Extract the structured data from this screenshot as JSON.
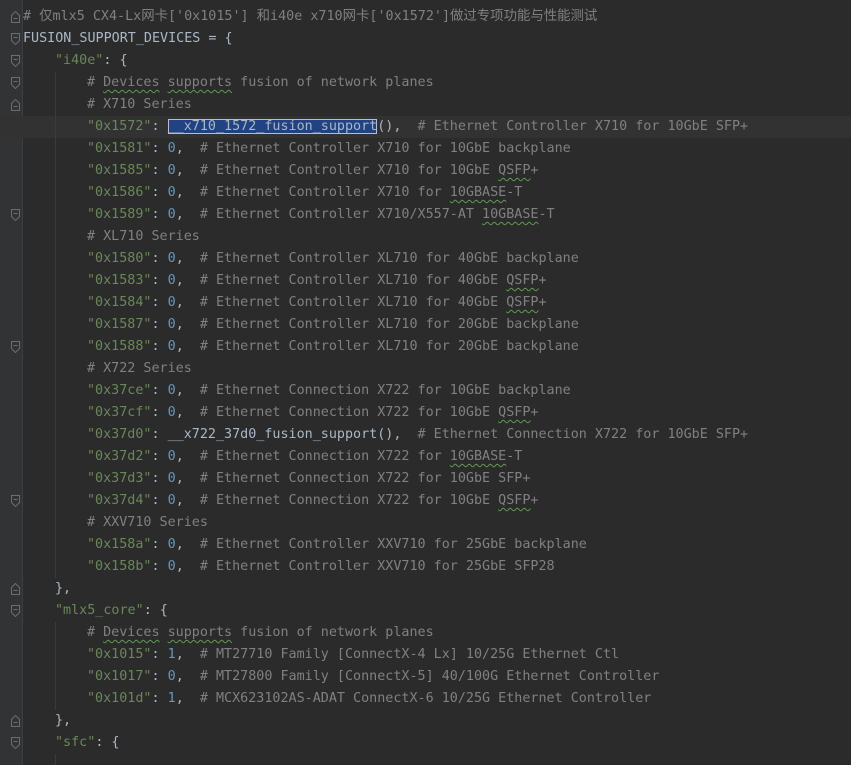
{
  "colors": {
    "background": "#2b2b2b",
    "gutter": "#313335",
    "text": "#a9b7c6",
    "string": "#6a8759",
    "number": "#6897bb",
    "comment": "#808080",
    "selection": "#214283"
  },
  "editor": {
    "lines": [
      {
        "indent": 0,
        "fold": "none",
        "tokens": [
          [
            "cm",
            "# ……………………"
          ]
        ]
      },
      {
        "indent": 0,
        "fold": "end",
        "tokens": [
          [
            "cm",
            "# 仅mlx5 CX4-Lx网卡['0x1015'] 和i40e x710网卡['0x1572']做过专项功能与性能测试"
          ]
        ]
      },
      {
        "indent": 0,
        "fold": "start",
        "tokens": [
          [
            "kw",
            "FUSION_SUPPORT_DEVICES = {"
          ]
        ]
      },
      {
        "indent": 1,
        "fold": "start",
        "tokens": [
          [
            "str",
            "\"i40e\""
          ],
          [
            "kw",
            ": {"
          ]
        ]
      },
      {
        "indent": 2,
        "fold": "start",
        "tokens": [
          [
            "cm",
            "# "
          ],
          [
            "cm spell",
            "Devices"
          ],
          [
            "cm",
            " "
          ],
          [
            "cm spell",
            "supports"
          ],
          [
            "cm",
            " fusion of network planes"
          ]
        ]
      },
      {
        "indent": 2,
        "fold": "end",
        "tokens": [
          [
            "cm",
            "# X710 Series"
          ]
        ]
      },
      {
        "indent": 2,
        "fold": "none",
        "current": true,
        "tokens": [
          [
            "str",
            "\"0x1572\""
          ],
          [
            "kw",
            ": "
          ],
          [
            "sel",
            "__x710_1572_fusion_support"
          ],
          [
            "kw",
            "(),  "
          ],
          [
            "cm",
            "# Ethernet Controller X710 for 10GbE SFP+"
          ]
        ]
      },
      {
        "indent": 2,
        "fold": "none",
        "tokens": [
          [
            "str",
            "\"0x1581\""
          ],
          [
            "kw",
            ": "
          ],
          [
            "num",
            "0"
          ],
          [
            "kw",
            ",  "
          ],
          [
            "cm",
            "# Ethernet Controller X710 for 10GbE backplane"
          ]
        ]
      },
      {
        "indent": 2,
        "fold": "none",
        "tokens": [
          [
            "str",
            "\"0x1585\""
          ],
          [
            "kw",
            ": "
          ],
          [
            "num",
            "0"
          ],
          [
            "kw",
            ",  "
          ],
          [
            "cm",
            "# Ethernet Controller X710 for 10GbE "
          ],
          [
            "cm spell",
            "QSFP"
          ],
          [
            "cm",
            "+"
          ]
        ]
      },
      {
        "indent": 2,
        "fold": "none",
        "tokens": [
          [
            "str",
            "\"0x1586\""
          ],
          [
            "kw",
            ": "
          ],
          [
            "num",
            "0"
          ],
          [
            "kw",
            ",  "
          ],
          [
            "cm",
            "# Ethernet Controller X710 for "
          ],
          [
            "cm spell",
            "10GBASE"
          ],
          [
            "cm",
            "-T"
          ]
        ]
      },
      {
        "indent": 2,
        "fold": "start",
        "tokens": [
          [
            "str",
            "\"0x1589\""
          ],
          [
            "kw",
            ": "
          ],
          [
            "num",
            "0"
          ],
          [
            "kw",
            ",  "
          ],
          [
            "cm",
            "# Ethernet Controller X710/X557-AT "
          ],
          [
            "cm spell",
            "10GBASE"
          ],
          [
            "cm",
            "-T"
          ]
        ]
      },
      {
        "indent": 2,
        "fold": "none",
        "tokens": [
          [
            "cm",
            "# XL710 Series"
          ]
        ]
      },
      {
        "indent": 2,
        "fold": "none",
        "tokens": [
          [
            "str",
            "\"0x1580\""
          ],
          [
            "kw",
            ": "
          ],
          [
            "num",
            "0"
          ],
          [
            "kw",
            ",  "
          ],
          [
            "cm",
            "# Ethernet Controller XL710 for 40GbE backplane"
          ]
        ]
      },
      {
        "indent": 2,
        "fold": "none",
        "tokens": [
          [
            "str",
            "\"0x1583\""
          ],
          [
            "kw",
            ": "
          ],
          [
            "num",
            "0"
          ],
          [
            "kw",
            ",  "
          ],
          [
            "cm",
            "# Ethernet Controller XL710 for 40GbE "
          ],
          [
            "cm spell",
            "QSFP"
          ],
          [
            "cm",
            "+"
          ]
        ]
      },
      {
        "indent": 2,
        "fold": "none",
        "tokens": [
          [
            "str",
            "\"0x1584\""
          ],
          [
            "kw",
            ": "
          ],
          [
            "num",
            "0"
          ],
          [
            "kw",
            ",  "
          ],
          [
            "cm",
            "# Ethernet Controller XL710 for 40GbE "
          ],
          [
            "cm spell",
            "QSFP"
          ],
          [
            "cm",
            "+"
          ]
        ]
      },
      {
        "indent": 2,
        "fold": "none",
        "tokens": [
          [
            "str",
            "\"0x1587\""
          ],
          [
            "kw",
            ": "
          ],
          [
            "num",
            "0"
          ],
          [
            "kw",
            ",  "
          ],
          [
            "cm",
            "# Ethernet Controller XL710 for 20GbE backplane"
          ]
        ]
      },
      {
        "indent": 2,
        "fold": "start",
        "tokens": [
          [
            "str",
            "\"0x1588\""
          ],
          [
            "kw",
            ": "
          ],
          [
            "num",
            "0"
          ],
          [
            "kw",
            ",  "
          ],
          [
            "cm",
            "# Ethernet Controller XL710 for 20GbE backplane"
          ]
        ]
      },
      {
        "indent": 2,
        "fold": "none",
        "tokens": [
          [
            "cm",
            "# X722 Series"
          ]
        ]
      },
      {
        "indent": 2,
        "fold": "none",
        "tokens": [
          [
            "str",
            "\"0x37ce\""
          ],
          [
            "kw",
            ": "
          ],
          [
            "num",
            "0"
          ],
          [
            "kw",
            ",  "
          ],
          [
            "cm",
            "# Ethernet Connection X722 for 10GbE backplane"
          ]
        ]
      },
      {
        "indent": 2,
        "fold": "none",
        "tokens": [
          [
            "str",
            "\"0x37cf\""
          ],
          [
            "kw",
            ": "
          ],
          [
            "num",
            "0"
          ],
          [
            "kw",
            ",  "
          ],
          [
            "cm",
            "# Ethernet Connection X722 for 10GbE "
          ],
          [
            "cm spell",
            "QSFP"
          ],
          [
            "cm",
            "+"
          ]
        ]
      },
      {
        "indent": 2,
        "fold": "none",
        "tokens": [
          [
            "str",
            "\"0x37d0\""
          ],
          [
            "kw",
            ": "
          ],
          [
            "fn",
            "__x722_37d0_fusion_support"
          ],
          [
            "kw",
            "(),  "
          ],
          [
            "cm",
            "# Ethernet Connection X722 for 10GbE SFP+"
          ]
        ]
      },
      {
        "indent": 2,
        "fold": "none",
        "tokens": [
          [
            "str",
            "\"0x37d2\""
          ],
          [
            "kw",
            ": "
          ],
          [
            "num",
            "0"
          ],
          [
            "kw",
            ",  "
          ],
          [
            "cm",
            "# Ethernet Connection X722 for "
          ],
          [
            "cm spell",
            "10GBASE"
          ],
          [
            "cm",
            "-T"
          ]
        ]
      },
      {
        "indent": 2,
        "fold": "none",
        "tokens": [
          [
            "str",
            "\"0x37d3\""
          ],
          [
            "kw",
            ": "
          ],
          [
            "num",
            "0"
          ],
          [
            "kw",
            ",  "
          ],
          [
            "cm",
            "# Ethernet Connection X722 for 10GbE SFP+"
          ]
        ]
      },
      {
        "indent": 2,
        "fold": "start",
        "tokens": [
          [
            "str",
            "\"0x37d4\""
          ],
          [
            "kw",
            ": "
          ],
          [
            "num",
            "0"
          ],
          [
            "kw",
            ",  "
          ],
          [
            "cm",
            "# Ethernet Connection X722 for 10GbE "
          ],
          [
            "cm spell",
            "QSFP"
          ],
          [
            "cm",
            "+"
          ]
        ]
      },
      {
        "indent": 2,
        "fold": "none",
        "tokens": [
          [
            "cm",
            "# XXV710 Series"
          ]
        ]
      },
      {
        "indent": 2,
        "fold": "none",
        "tokens": [
          [
            "str",
            "\"0x158a\""
          ],
          [
            "kw",
            ": "
          ],
          [
            "num",
            "0"
          ],
          [
            "kw",
            ",  "
          ],
          [
            "cm",
            "# Ethernet Controller XXV710 for 25GbE backplane"
          ]
        ]
      },
      {
        "indent": 2,
        "fold": "none",
        "tokens": [
          [
            "str",
            "\"0x158b\""
          ],
          [
            "kw",
            ": "
          ],
          [
            "num",
            "0"
          ],
          [
            "kw",
            ",  "
          ],
          [
            "cm",
            "# Ethernet Controller XXV710 for 25GbE SFP28"
          ]
        ]
      },
      {
        "indent": 1,
        "fold": "end",
        "tokens": [
          [
            "kw",
            "},"
          ]
        ]
      },
      {
        "indent": 1,
        "fold": "start",
        "tokens": [
          [
            "str",
            "\"mlx5_core\""
          ],
          [
            "kw",
            ": {"
          ]
        ]
      },
      {
        "indent": 2,
        "fold": "none",
        "tokens": [
          [
            "cm",
            "# "
          ],
          [
            "cm spell",
            "Devices"
          ],
          [
            "cm",
            " "
          ],
          [
            "cm spell",
            "supports"
          ],
          [
            "cm",
            " fusion of network planes"
          ]
        ]
      },
      {
        "indent": 2,
        "fold": "none",
        "tokens": [
          [
            "str",
            "\"0x1015\""
          ],
          [
            "kw",
            ": "
          ],
          [
            "num",
            "1"
          ],
          [
            "kw",
            ",  "
          ],
          [
            "cm",
            "# MT27710 Family [ConnectX-4 Lx] 10/25G Ethernet Ctl"
          ]
        ]
      },
      {
        "indent": 2,
        "fold": "none",
        "tokens": [
          [
            "str",
            "\"0x1017\""
          ],
          [
            "kw",
            ": "
          ],
          [
            "num",
            "0"
          ],
          [
            "kw",
            ",  "
          ],
          [
            "cm",
            "# MT27800 Family [ConnectX-5] 40/100G Ethernet Controller"
          ]
        ]
      },
      {
        "indent": 2,
        "fold": "none",
        "tokens": [
          [
            "str",
            "\"0x101d\""
          ],
          [
            "kw",
            ": "
          ],
          [
            "num",
            "1"
          ],
          [
            "kw",
            ",  "
          ],
          [
            "cm",
            "# MCX623102AS-ADAT ConnectX-6 10/25G Ethernet Controller"
          ]
        ]
      },
      {
        "indent": 1,
        "fold": "end",
        "tokens": [
          [
            "kw",
            "},"
          ]
        ]
      },
      {
        "indent": 1,
        "fold": "start",
        "tokens": [
          [
            "str",
            "\"sfc\""
          ],
          [
            "kw",
            ": {"
          ]
        ]
      },
      {
        "indent": 2,
        "fold": "none",
        "tokens": [
          [
            "cm",
            ""
          ]
        ]
      }
    ]
  }
}
